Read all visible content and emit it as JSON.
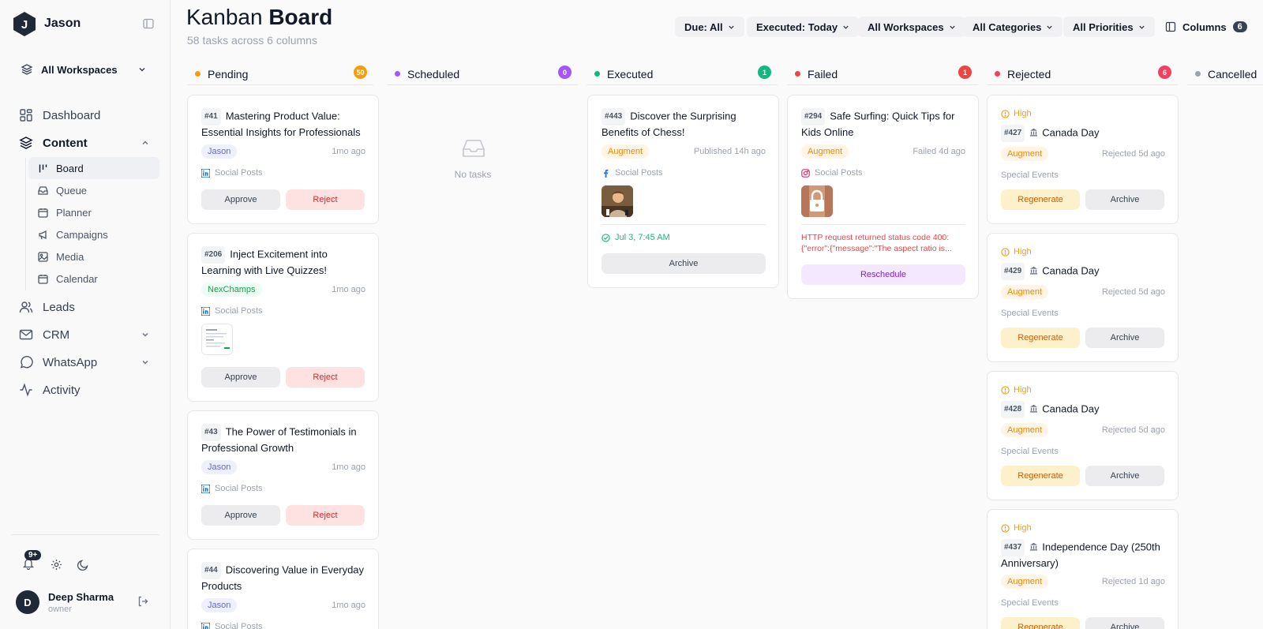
{
  "sidebar": {
    "user_name": "Jason",
    "logo_letter": "J",
    "workspace": "All Workspaces",
    "nav": {
      "dashboard": "Dashboard",
      "content": "Content",
      "leads": "Leads",
      "crm": "CRM",
      "whatsapp": "WhatsApp",
      "activity": "Activity"
    },
    "sub": {
      "board": "Board",
      "queue": "Queue",
      "planner": "Planner",
      "campaigns": "Campaigns",
      "media": "Media",
      "calendar": "Calendar"
    },
    "notif_badge": "9+",
    "account": {
      "initial": "D",
      "name": "Deep Sharma",
      "role": "owner"
    }
  },
  "header": {
    "title_light": "Kanban",
    "title_bold": "Board",
    "subtitle": "58 tasks across 6 columns",
    "filters": {
      "due": "Due: All",
      "executed": "Executed: Today",
      "workspaces": "All Workspaces",
      "categories": "All Categories",
      "priorities": "All Priorities"
    },
    "columns_label": "Columns",
    "columns_count": "6"
  },
  "columns": {
    "pending": {
      "label": "Pending",
      "count": "50",
      "color": "#f59e0b"
    },
    "scheduled": {
      "label": "Scheduled",
      "count": "0",
      "color": "#a855f7",
      "empty": "No tasks"
    },
    "executed": {
      "label": "Executed",
      "count": "1",
      "color": "#10b981"
    },
    "failed": {
      "label": "Failed",
      "count": "1",
      "color": "#ef4444"
    },
    "rejected": {
      "label": "Rejected",
      "count": "6",
      "color": "#f43f5e"
    },
    "cancelled": {
      "label": "Cancelled",
      "color": "#9ca3af"
    }
  },
  "pending_cards": [
    {
      "id": "#41",
      "title": "Mastering Product Value: Essential Insights for Professionals",
      "tag": "Jason",
      "time": "1mo ago",
      "source": "Social Posts",
      "approve": "Approve",
      "reject": "Reject"
    },
    {
      "id": "#206",
      "title": "Inject Excitement into Learning with Live Quizzes!",
      "tag": "NexChamps",
      "time": "1mo ago",
      "source": "Social Posts",
      "approve": "Approve",
      "reject": "Reject"
    },
    {
      "id": "#43",
      "title": "The Power of Testimonials in Professional Growth",
      "tag": "Jason",
      "time": "1mo ago",
      "source": "Social Posts",
      "approve": "Approve",
      "reject": "Reject"
    },
    {
      "id": "#44",
      "title": "Discovering Value in Everyday Products",
      "tag": "Jason",
      "time": "1mo ago",
      "source": "Social Posts"
    }
  ],
  "executed_card": {
    "id": "#443",
    "title": "Discover the Surprising Benefits of Chess!",
    "tag": "Augment",
    "time": "Published 14h ago",
    "source": "Social Posts",
    "date": "Jul 3, 7:45 AM",
    "archive": "Archive"
  },
  "failed_card": {
    "id": "#294",
    "title": "Safe Surfing: Quick Tips for Kids Online",
    "tag": "Augment",
    "time": "Failed 4d ago",
    "source": "Social Posts",
    "error": "HTTP request returned status code 400: {\"error\":{\"message\":\"The aspect ratio is...",
    "reschedule": "Reschedule"
  },
  "rejected_cards": [
    {
      "priority": "High",
      "id": "#427",
      "title": "Canada Day",
      "tag": "Augment",
      "time": "Rejected 5d ago",
      "category": "Special Events",
      "regenerate": "Regenerate",
      "archive": "Archive"
    },
    {
      "priority": "High",
      "id": "#429",
      "title": "Canada Day",
      "tag": "Augment",
      "time": "Rejected 5d ago",
      "category": "Special Events",
      "regenerate": "Regenerate",
      "archive": "Archive"
    },
    {
      "priority": "High",
      "id": "#428",
      "title": "Canada Day",
      "tag": "Augment",
      "time": "Rejected 5d ago",
      "category": "Special Events",
      "regenerate": "Regenerate",
      "archive": "Archive"
    },
    {
      "priority": "High",
      "id": "#437",
      "title": "Independence Day (250th Anniversary)",
      "tag": "Augment",
      "time": "Rejected 1d ago",
      "category": "Special Events",
      "regenerate": "Regenerate",
      "archive": "Archive"
    }
  ]
}
